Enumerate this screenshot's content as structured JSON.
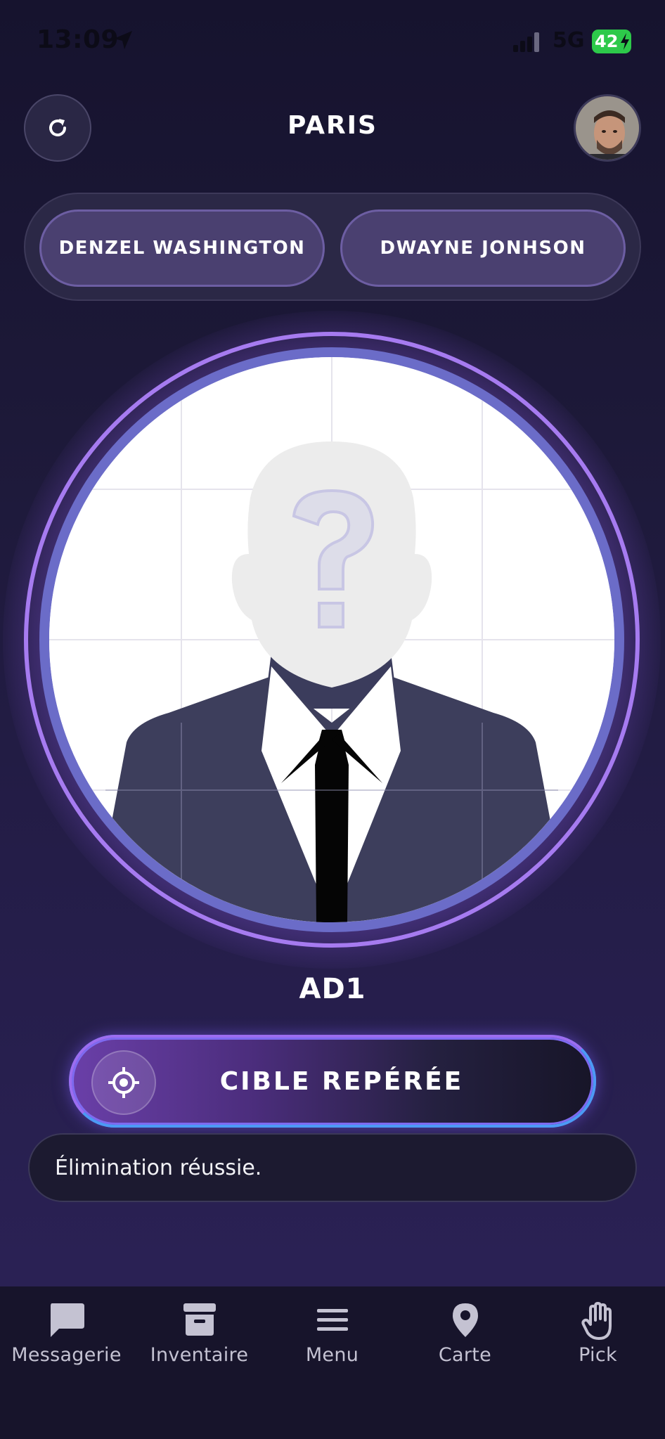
{
  "status_bar": {
    "time": "13:09",
    "network": "5G",
    "battery": "42"
  },
  "header": {
    "city": "PARIS",
    "refresh_icon": "refresh-icon",
    "avatar": "user-avatar"
  },
  "targets": [
    {
      "label": "DENZEL WASHINGTON"
    },
    {
      "label": "DWAYNE JONHSON"
    }
  ],
  "portrait": {
    "placeholder_icon": "unknown-person-icon"
  },
  "agent": {
    "code_name": "AD1"
  },
  "action": {
    "label": "CIBLE REPÉRÉE",
    "icon": "crosshair-icon"
  },
  "message": {
    "text": "Élimination réussie."
  },
  "nav": [
    {
      "label": "Messagerie",
      "icon": "chat-bubble-icon"
    },
    {
      "label": "Inventaire",
      "icon": "archive-box-icon"
    },
    {
      "label": "Menu",
      "icon": "hamburger-menu-icon"
    },
    {
      "label": "Carte",
      "icon": "map-pin-icon"
    },
    {
      "label": "Pick",
      "icon": "hand-icon"
    }
  ],
  "colors": {
    "accent_purple": "#a67bf0",
    "accent_blue": "#4c9af5",
    "background": "#1d1939",
    "chip": "#4a4070"
  }
}
